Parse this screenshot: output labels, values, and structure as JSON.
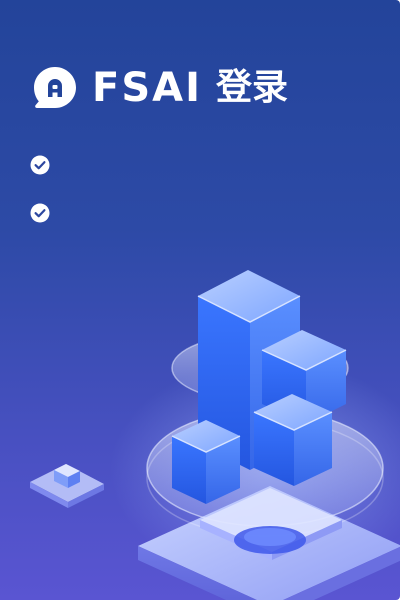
{
  "brand": {
    "logo_icon": "chat-bubble-logo-icon",
    "name": "FSAI",
    "suffix": "登录"
  },
  "features": [
    {
      "icon": "check-circle-icon"
    },
    {
      "icon": "check-circle-icon"
    }
  ],
  "illustration": {
    "icon": "isometric-cubes-illustration"
  },
  "colors": {
    "background_top": "#23449a",
    "background_bottom": "#5a55d2",
    "text": "#ffffff",
    "cube_blue": "#2f63f0"
  }
}
